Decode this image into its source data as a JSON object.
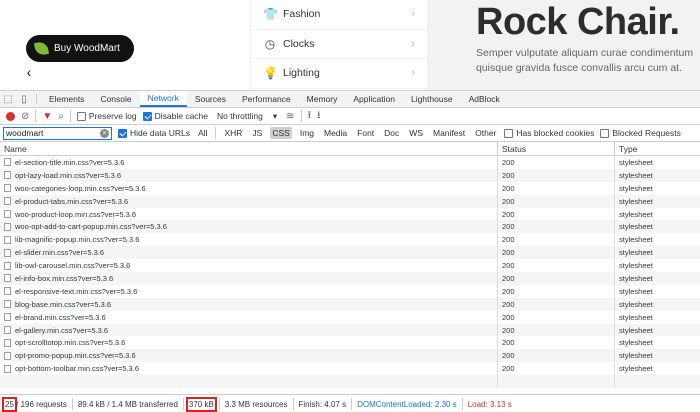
{
  "site": {
    "buy_button": "Buy WoodMart",
    "prev_arrow": "‹",
    "menu": [
      {
        "label": "Fashion",
        "icon": "shirt-icon"
      },
      {
        "label": "Clocks",
        "icon": "clock-icon"
      },
      {
        "label": "Lighting",
        "icon": "lightbulb-icon"
      }
    ],
    "hero_title": "Rock Chair.",
    "hero_text": "Semper vulputate aliquam curae condimentum quisque gravida fusce convallis arcu cum at."
  },
  "devtools": {
    "tabs": [
      "Elements",
      "Console",
      "Network",
      "Sources",
      "Performance",
      "Memory",
      "Application",
      "Lighthouse",
      "AdBlock"
    ],
    "active_tab": "Network",
    "toolbar": {
      "preserve_log": "Preserve log",
      "disable_cache": "Disable cache",
      "throttling": "No throttling"
    },
    "filter": {
      "value": "woodmart",
      "hide_data_urls": "Hide data URLs",
      "types": [
        "All",
        "XHR",
        "JS",
        "CSS",
        "Img",
        "Media",
        "Font",
        "Doc",
        "WS",
        "Manifest",
        "Other"
      ],
      "active_type": "CSS",
      "blocked_cookies": "Has blocked cookies",
      "blocked_requests": "Blocked Requests"
    },
    "columns": {
      "name": "Name",
      "status": "Status",
      "type": "Type"
    },
    "rows": [
      {
        "name": "el-section-title.min.css?ver=5.3.6",
        "status": "200",
        "type": "stylesheet"
      },
      {
        "name": "opt-lazy-load.min.css?ver=5.3.6",
        "status": "200",
        "type": "stylesheet"
      },
      {
        "name": "woo-categories-loop.min.css?ver=5.3.6",
        "status": "200",
        "type": "stylesheet"
      },
      {
        "name": "el-product-tabs.min.css?ver=5.3.6",
        "status": "200",
        "type": "stylesheet"
      },
      {
        "name": "woo-product-loop.min.css?ver=5.3.6",
        "status": "200",
        "type": "stylesheet"
      },
      {
        "name": "woo-opt-add-to-cart-popup.min.css?ver=5.3.6",
        "status": "200",
        "type": "stylesheet"
      },
      {
        "name": "lib-magnific-popup.min.css?ver=5.3.6",
        "status": "200",
        "type": "stylesheet"
      },
      {
        "name": "el-slider.min.css?ver=5.3.6",
        "status": "200",
        "type": "stylesheet"
      },
      {
        "name": "lib-owl-carousel.min.css?ver=5.3.6",
        "status": "200",
        "type": "stylesheet"
      },
      {
        "name": "el-info-box.min.css?ver=5.3.6",
        "status": "200",
        "type": "stylesheet"
      },
      {
        "name": "el-responsive-text.min.css?ver=5.3.6",
        "status": "200",
        "type": "stylesheet"
      },
      {
        "name": "blog-base.min.css?ver=5.3.6",
        "status": "200",
        "type": "stylesheet"
      },
      {
        "name": "el-brand.min.css?ver=5.3.6",
        "status": "200",
        "type": "stylesheet"
      },
      {
        "name": "el-gallery.min.css?ver=5.3.6",
        "status": "200",
        "type": "stylesheet"
      },
      {
        "name": "opt-scrolltotop.min.css?ver=5.3.6",
        "status": "200",
        "type": "stylesheet"
      },
      {
        "name": "opt-promo-popup.min.css?ver=5.3.6",
        "status": "200",
        "type": "stylesheet"
      },
      {
        "name": "opt-bottom-toolbar.min.css?ver=5.3.6",
        "status": "200",
        "type": "stylesheet"
      },
      {
        "name": "",
        "status": "",
        "type": ""
      }
    ],
    "statusbar": {
      "count": "25",
      "count_rest": "/ 196 requests",
      "transferred": "89.4 kB / 1.4 MB transferred",
      "size": "370 kB",
      "resources": "3.3 MB resources",
      "finish": "Finish: 4.07 s",
      "dom_loaded": "DOMContentLoaded: 2.30 s",
      "load": "Load: 3.13 s"
    }
  }
}
